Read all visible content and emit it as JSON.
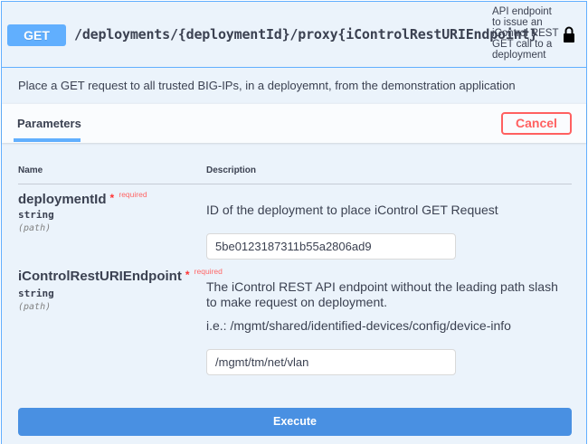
{
  "operation": {
    "method": "GET",
    "path": "/deployments/{deploymentId}/proxy{iControlRestURIEndpoint}",
    "summary": "API endpoint to issue an iControl REST GET call to a deployment",
    "summary_lines": [
      "API endpoint",
      "to issue an",
      "iControl REST",
      "GET call to a",
      "deployment"
    ],
    "description": "Place a GET request to all trusted BIG-IPs, in a deployemnt, from the demonstration application",
    "lock_icon": "lock-icon"
  },
  "section": {
    "tab_label": "Parameters",
    "cancel_label": "Cancel"
  },
  "table": {
    "col_name": "Name",
    "col_description": "Description"
  },
  "parameters": [
    {
      "name": "deploymentId",
      "required_star": "*",
      "required_label": "required",
      "type": "string",
      "in": "(path)",
      "description": "ID of the deployment to place iControl GET Request",
      "value": "5be0123187311b55a2806ad9"
    },
    {
      "name": "iControlRestURIEndpoint",
      "required_star": "*",
      "required_label": "required",
      "type": "string",
      "in": "(path)",
      "description": "The iControl REST API endpoint without the leading path slash to make request on deployment.",
      "example": "i.e.: /mgmt/shared/identified-devices/config/device-info",
      "value": "/mgmt/tm/net/vlan"
    }
  ],
  "execute_label": "Execute",
  "colors": {
    "get_blue": "#61affe",
    "background": "#ebf3fb",
    "cancel_red": "#ff6060",
    "execute_blue": "#4990e2"
  }
}
